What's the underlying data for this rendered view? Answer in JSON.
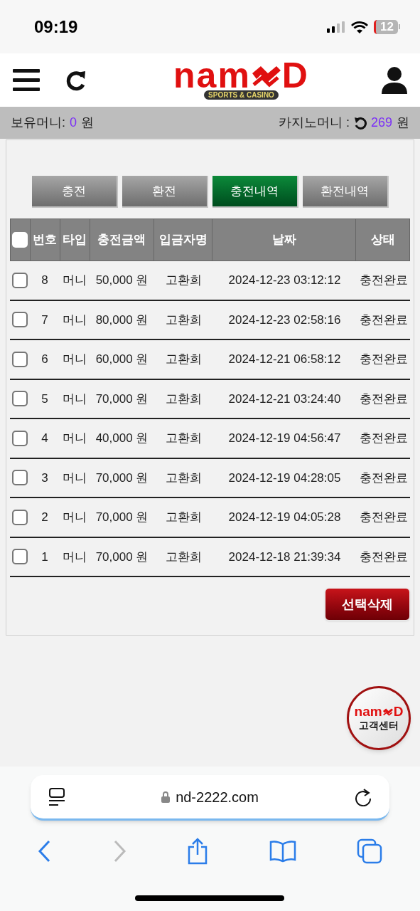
{
  "status_bar": {
    "time": "09:19",
    "battery": "12"
  },
  "header": {
    "logo": {
      "left": "nam",
      "right": "D",
      "tagline": "SPORTS & CASINO"
    }
  },
  "balance_bar": {
    "money_label": "보유머니:",
    "money_value": "0",
    "money_unit": "원",
    "casino_label": "카지노머니 :",
    "casino_value": "269",
    "casino_unit": "원"
  },
  "tabs": [
    {
      "label": "충전",
      "selected": false
    },
    {
      "label": "환전",
      "selected": false
    },
    {
      "label": "충전내역",
      "selected": true
    },
    {
      "label": "환전내역",
      "selected": false
    }
  ],
  "table": {
    "select_all_checked": false,
    "columns": [
      "번호",
      "타입",
      "충전금액",
      "입금자명",
      "날짜",
      "상태"
    ],
    "rows": [
      {
        "checked": false,
        "cells": [
          "8",
          "머니",
          "50,000 원",
          "고환희",
          "2024-12-23 03:12:12",
          "충전완료"
        ]
      },
      {
        "checked": false,
        "cells": [
          "7",
          "머니",
          "80,000 원",
          "고환희",
          "2024-12-23 02:58:16",
          "충전완료"
        ]
      },
      {
        "checked": false,
        "cells": [
          "6",
          "머니",
          "60,000 원",
          "고환희",
          "2024-12-21 06:58:12",
          "충전완료"
        ]
      },
      {
        "checked": false,
        "cells": [
          "5",
          "머니",
          "70,000 원",
          "고환희",
          "2024-12-21 03:24:40",
          "충전완료"
        ]
      },
      {
        "checked": false,
        "cells": [
          "4",
          "머니",
          "40,000 원",
          "고환희",
          "2024-12-19 04:56:47",
          "충전완료"
        ]
      },
      {
        "checked": false,
        "cells": [
          "3",
          "머니",
          "70,000 원",
          "고환희",
          "2024-12-19 04:28:05",
          "충전완료"
        ]
      },
      {
        "checked": false,
        "cells": [
          "2",
          "머니",
          "70,000 원",
          "고환희",
          "2024-12-19 04:05:28",
          "충전완료"
        ]
      },
      {
        "checked": false,
        "cells": [
          "1",
          "머니",
          "70,000 원",
          "고환희",
          "2024-12-18 21:39:34",
          "충전완료"
        ]
      }
    ]
  },
  "delete_button": "선택삭제",
  "support_badge": {
    "logo_left": "nam",
    "logo_right": "D",
    "label": "고객센터"
  },
  "browser": {
    "url": "nd-2222.com"
  }
}
